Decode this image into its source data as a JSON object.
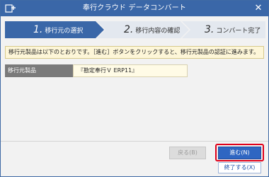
{
  "window": {
    "title": "奉行クラウド データコンバート",
    "close_symbol": "✕",
    "app_icon": "app-plus-icon",
    "title_bar_color": "#3a67a8"
  },
  "steps": [
    {
      "number": "1.",
      "label": "移行元の選択",
      "active": true
    },
    {
      "number": "2.",
      "label": "移行内容の確認",
      "active": false
    },
    {
      "number": "3.",
      "label": "コンバート完了",
      "active": false
    }
  ],
  "step_colors": {
    "active": "#3a67a8",
    "inactive": "#e3e8ef"
  },
  "notice": {
    "text": "移行元製品は以下のとおりです。［進む］ボタンをクリックすると、移行元製品の認証に進みます。"
  },
  "source_product": {
    "label": "移行元製品",
    "value": "『勘定奉行Ｖ ERP11』"
  },
  "buttons": {
    "back": "戻る(B)",
    "next": "進む(N)",
    "exit": "終了する(X)"
  },
  "colors": {
    "highlight": "#e0001a",
    "primary_button": "#2f66c2"
  }
}
